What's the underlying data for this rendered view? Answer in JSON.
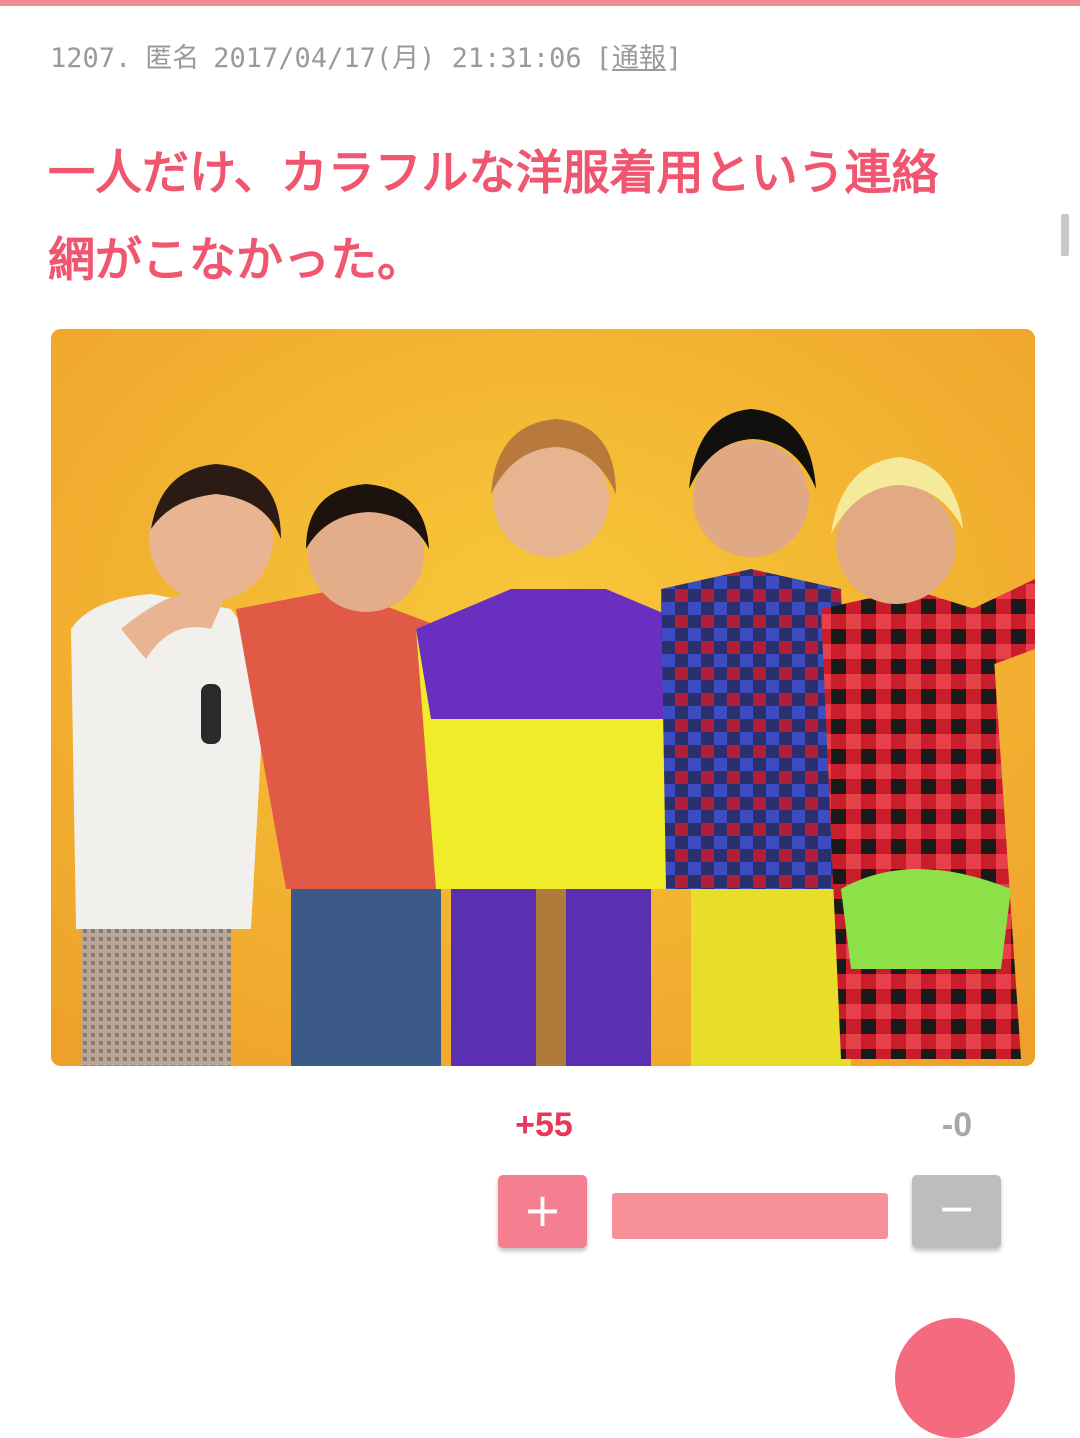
{
  "comment": {
    "number": "1207.",
    "author": "匿名",
    "datetime": "2017/04/17(月) 21:31:06",
    "report_open": "[",
    "report_label": "通報",
    "report_close": "]",
    "body_line1": "一人だけ、カラフルな洋服着用という連絡",
    "body_line2": "網がこなかった。"
  },
  "photo": {
    "icon": "photo-of-five-men",
    "background_color": "#f3b52f"
  },
  "votes": {
    "plus_count": "+55",
    "minus_count": "-0",
    "plus_symbol": "+",
    "minus_symbol": "−",
    "plus_ratio": 1.0
  },
  "colors": {
    "accent": "#f0566f",
    "plus_button": "#f47f91",
    "minus_button": "#bdbdbd",
    "plus_count": "#e8375a",
    "meta_text": "#9a9a9a"
  }
}
